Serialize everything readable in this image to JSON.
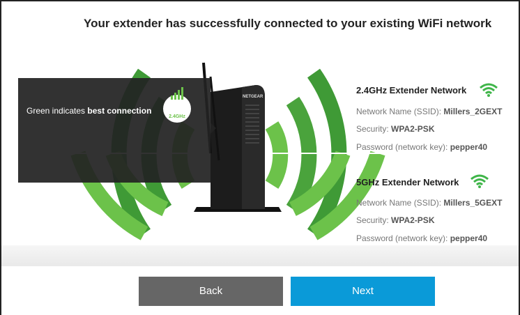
{
  "title": "Your extender has successfully connected to your existing WiFi network",
  "tooltip": {
    "prefix": "Green indicates ",
    "emphasis": "best connection",
    "badge_label": "2.4GHz"
  },
  "networks": [
    {
      "heading": "2.4GHz Extender Network",
      "ssid_label": "Network Name (SSID):",
      "ssid": "Millers_2GEXT",
      "security_label": "Security:",
      "security": "WPA2-PSK",
      "password_label": "Password (network key):",
      "password": "pepper40",
      "icon": "wifi-icon"
    },
    {
      "heading": "5GHz Extender Network",
      "ssid_label": "Network Name (SSID):",
      "ssid": "Millers_5GEXT",
      "security_label": "Security:",
      "security": "WPA2-PSK",
      "password_label": "Password (network key):",
      "password": "pepper40",
      "icon": "wifi-icon"
    }
  ],
  "device_brand": "NETGEAR",
  "buttons": {
    "back": "Back",
    "next": "Next"
  },
  "colors": {
    "wave_dark": "#3f9a36",
    "wave_light": "#6cc24a",
    "back_button": "#666666",
    "next_button": "#0a9ad8"
  }
}
